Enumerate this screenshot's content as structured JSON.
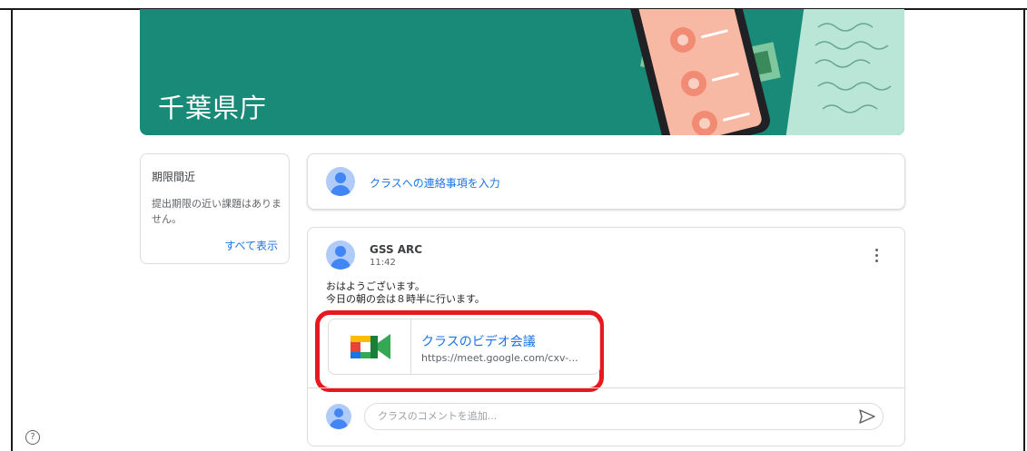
{
  "banner": {
    "title": "千葉県庁"
  },
  "due": {
    "title": "期限間近",
    "text": "提出期限の近い課題はありません。",
    "view_all": "すべて表示"
  },
  "announce": {
    "placeholder": "クラスへの連絡事項を入力"
  },
  "post": {
    "author": "GSS ARC",
    "time": "11:42",
    "lines": [
      "おはようございます。",
      "今日の朝の会は８時半に行います。"
    ],
    "attachment": {
      "title": "クラスのビデオ会議",
      "url": "https://meet.google.com/cxv-..."
    },
    "comment_placeholder": "クラスのコメントを追加..."
  },
  "help": {
    "icon": "help-icon",
    "glyph": "?"
  },
  "colors": {
    "banner": "#1a8a78",
    "accent": "#1a73e8",
    "highlight": "#e8181e"
  }
}
